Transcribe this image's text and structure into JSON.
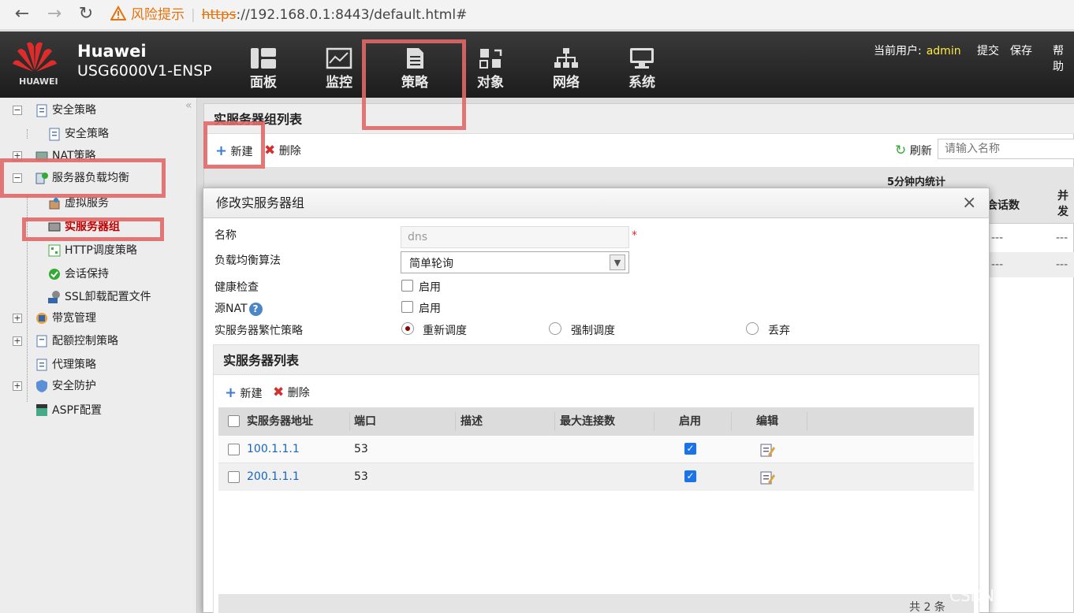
{
  "browser": {
    "back": "←",
    "forward": "→",
    "reload": "↻",
    "warning": "风险提示",
    "url_scheme": "https",
    "url_rest": "://192.168.0.1:8443/default.html#"
  },
  "header": {
    "brand": "Huawei",
    "model": "USG6000V1-ENSP",
    "logo_text": "HUAWEI",
    "nav": [
      {
        "label": "面板",
        "icon": "dashboard-icon"
      },
      {
        "label": "监控",
        "icon": "monitor-icon"
      },
      {
        "label": "策略",
        "icon": "policy-icon"
      },
      {
        "label": "对象",
        "icon": "object-icon"
      },
      {
        "label": "网络",
        "icon": "network-icon"
      },
      {
        "label": "系统",
        "icon": "system-icon"
      }
    ],
    "user_label": "当前用户:",
    "user": "admin",
    "submit": "提交",
    "save": "保存",
    "help": "帮助"
  },
  "sidebar": {
    "collapse": "«",
    "items": [
      {
        "label": "安全策略",
        "level": 0,
        "pm": "−"
      },
      {
        "label": "安全策略",
        "level": 1
      },
      {
        "label": "NAT策略",
        "level": 0,
        "pm": "+"
      },
      {
        "label": "服务器负载均衡",
        "level": 0,
        "pm": "−"
      },
      {
        "label": "虚拟服务",
        "level": 1
      },
      {
        "label": "实服务器组",
        "level": 1,
        "active": true
      },
      {
        "label": "HTTP调度策略",
        "level": 1
      },
      {
        "label": "会话保持",
        "level": 1
      },
      {
        "label": "SSL卸载配置文件",
        "level": 1
      },
      {
        "label": "带宽管理",
        "level": 0,
        "pm": "+"
      },
      {
        "label": "配额控制策略",
        "level": 0,
        "pm": "+"
      },
      {
        "label": "代理策略",
        "level": 0
      },
      {
        "label": "安全防护",
        "level": 0,
        "pm": "+"
      },
      {
        "label": "ASPF配置",
        "level": 0
      }
    ]
  },
  "content": {
    "title": "实服务器组列表",
    "new": "新建",
    "delete": "删除",
    "refresh": "刷新",
    "search_placeholder": "请输入名称",
    "stats_header": "5分钟内统计",
    "col_sessions": "会话数",
    "col_concurrent": "并发",
    "dash": "---"
  },
  "modal": {
    "title": "修改实服务器组",
    "close": "×",
    "fields": {
      "name_label": "名称",
      "name_value": "dns",
      "required": "*",
      "algo_label": "负载均衡算法",
      "algo_value": "简单轮询",
      "health_label": "健康检查",
      "health_opt": "启用",
      "snat_label": "源NAT",
      "snat_opt": "启用",
      "busy_label": "实服务器繁忙策略",
      "busy_options": [
        "重新调度",
        "强制调度",
        "丢弃"
      ]
    },
    "inner": {
      "title": "实服务器列表",
      "new": "新建",
      "delete": "删除",
      "columns": [
        "实服务器地址",
        "端口",
        "描述",
        "最大连接数",
        "启用",
        "编辑"
      ],
      "rows": [
        {
          "addr": "100.1.1.1",
          "port": "53",
          "desc": "",
          "max": "",
          "enabled": true
        },
        {
          "addr": "200.1.1.1",
          "port": "53",
          "desc": "",
          "max": "",
          "enabled": true
        }
      ],
      "footer": "共 2 条"
    }
  },
  "watermark": "CSDN @墨宇",
  "colors": {
    "accent": "#1a73e8",
    "highlight": "#e06767",
    "active_text": "#c00000",
    "link": "#1565c0"
  }
}
